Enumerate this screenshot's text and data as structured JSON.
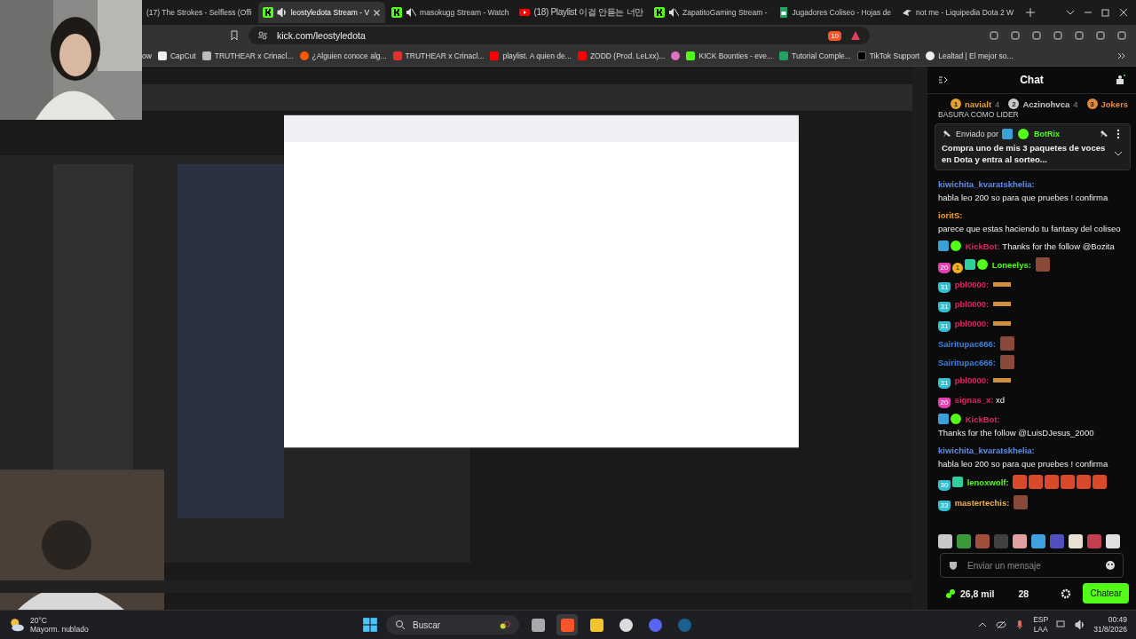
{
  "tabs": [
    {
      "title": "(17) The Strokes - Selfless (Offi",
      "selected": false
    },
    {
      "title": "leostyledota Stream - V",
      "kind": "kick",
      "playing": true,
      "muted": false,
      "selected": true
    },
    {
      "title": "masokugg Stream - Watch",
      "kind": "kick",
      "playing": true,
      "muted": true,
      "selected": false
    },
    {
      "title": "(18) Playlist 이걸 안듣는 너만",
      "kind": "youtube",
      "selected": false
    },
    {
      "title": "ZapatitoGaming Stream -",
      "kind": "kick",
      "playing": true,
      "muted": true,
      "selected": false
    },
    {
      "title": "Jugadores Coliseo - Hojas de",
      "kind": "sheets",
      "selected": false
    },
    {
      "title": "not me - Liquipedia Dota 2 W",
      "kind": "liquipedia",
      "selected": false
    }
  ],
  "address": {
    "url": "kick.com/leostyledota",
    "shield_count": "10"
  },
  "bookmarks": [
    {
      "label": "ow"
    },
    {
      "label": "CapCut",
      "kind": "capcut"
    },
    {
      "label": "TRUTHEAR x Crinacl...",
      "kind": "truthear"
    },
    {
      "label": "¿Alguien conoce alg...",
      "kind": "reddit"
    },
    {
      "label": "TRUTHEAR x Crinacl...",
      "kind": "shop"
    },
    {
      "label": "playlist. A quien de...",
      "kind": "youtube"
    },
    {
      "label": "ZODD (Prod. LeLxx)...",
      "kind": "youtube"
    },
    {
      "kind": "dot"
    },
    {
      "label": "KICK Bounties - eve...",
      "kind": "kick"
    },
    {
      "label": "Tutorial Comple...",
      "kind": "sheets"
    },
    {
      "label": "TikTok Support",
      "kind": "tiktok"
    },
    {
      "label": "Lealtad | El mejor so...",
      "kind": "bird"
    }
  ],
  "chat": {
    "title": "Chat",
    "leaders": [
      {
        "rank": "1",
        "name": "navialt",
        "count": "4",
        "color": "#e0a030"
      },
      {
        "rank": "2",
        "name": "Aczinohvca",
        "count": "4",
        "color": "#c8c8c8"
      },
      {
        "rank": "3",
        "name": "Jokers",
        "color": "#e08a40"
      }
    ],
    "clipped_message": "BASURA COMO LIDER",
    "pinned": {
      "label": "Enviado por",
      "user": "BotRix",
      "text": "Compra uno de mis 3 paquetes de voces en Dota y entra al sorteo..."
    },
    "messages": [
      {
        "user": "kiwichita_kvaratskhelia:",
        "color": "#5b8def",
        "text": "habla leo 200 so para que pruebes ! confirma"
      },
      {
        "user": "ioritS:",
        "color": "#f0a030",
        "text": "parece que estas haciendo tu fantasy del coliseo"
      },
      {
        "user": "KickBot:",
        "color": "#e0245e",
        "badges": [
          {
            "kind": "mod"
          },
          {
            "kind": "verified"
          }
        ],
        "text": "Thanks for the follow @Bozita"
      },
      {
        "user": "Loneelys:",
        "color": "#53fc18",
        "badges": [
          {
            "kind": "sub",
            "label": "20",
            "color": "#e040b0"
          },
          {
            "kind": "coin",
            "label": "1",
            "color": "#f0b020"
          },
          {
            "kind": "gift"
          },
          {
            "kind": "verified"
          }
        ],
        "emotes": [
          {
            "kind": "face"
          }
        ]
      },
      {
        "user": "pbl0000:",
        "color": "#e0245e",
        "badges": [
          {
            "kind": "sub",
            "label": "31",
            "color": "#30c0d0"
          }
        ],
        "emotes": [
          {
            "kind": "bar"
          }
        ]
      },
      {
        "user": "pbl0000:",
        "color": "#e0245e",
        "badges": [
          {
            "kind": "sub",
            "label": "31",
            "color": "#30c0d0"
          }
        ],
        "emotes": [
          {
            "kind": "bar"
          }
        ]
      },
      {
        "user": "pbl0000:",
        "color": "#e0245e",
        "badges": [
          {
            "kind": "sub",
            "label": "31",
            "color": "#30c0d0"
          }
        ],
        "emotes": [
          {
            "kind": "bar"
          }
        ]
      },
      {
        "user": "Sairitupac666:",
        "color": "#3f7fe0",
        "emotes": [
          {
            "kind": "face"
          }
        ]
      },
      {
        "user": "Sairitupac666:",
        "color": "#3f7fe0",
        "emotes": [
          {
            "kind": "face"
          }
        ]
      },
      {
        "user": "pbl0000:",
        "color": "#e0245e",
        "badges": [
          {
            "kind": "sub",
            "label": "31",
            "color": "#30c0d0"
          }
        ],
        "emotes": [
          {
            "kind": "bar"
          }
        ]
      },
      {
        "user": "signas_x:",
        "color": "#e0245e",
        "badges": [
          {
            "kind": "sub",
            "label": "20",
            "color": "#e040b0"
          }
        ],
        "text": "xd"
      },
      {
        "user": "KickBot:",
        "color": "#e0245e",
        "badges": [
          {
            "kind": "mod"
          },
          {
            "kind": "verified"
          }
        ],
        "text": "Thanks for the follow @LuisDJesus_2000"
      },
      {
        "user": "kiwichita_kvaratskhelia:",
        "color": "#5b8def",
        "text": "habla leo 200 so para que pruebes ! confirma"
      },
      {
        "user": "lenoxwolf:",
        "color": "#53fc18",
        "badges": [
          {
            "kind": "sub",
            "label": "30",
            "color": "#30c0d0"
          },
          {
            "kind": "gift"
          }
        ],
        "emotes": [
          {
            "kind": "red"
          },
          {
            "kind": "red"
          },
          {
            "kind": "red"
          },
          {
            "kind": "red"
          },
          {
            "kind": "red"
          },
          {
            "kind": "red"
          }
        ]
      },
      {
        "user": "mastertechis:",
        "color": "#f0b040",
        "badges": [
          {
            "kind": "sub",
            "label": "33",
            "color": "#30c0d0"
          }
        ],
        "emotes": [
          {
            "kind": "face"
          }
        ]
      }
    ],
    "quick_emotes": [
      {
        "color": "#c8c8c8"
      },
      {
        "color": "#3a9a3a"
      },
      {
        "color": "#a0503a"
      },
      {
        "color": "#404040"
      },
      {
        "color": "#e0a0a0"
      },
      {
        "color": "#40a0e0"
      },
      {
        "color": "#5050c0"
      },
      {
        "color": "#e8e0d0"
      },
      {
        "color": "#c04050"
      },
      {
        "color": "#e0e0e0"
      }
    ],
    "input": {
      "placeholder": "Enviar un mensaje"
    },
    "viewers": "26,8 mil",
    "count": "28",
    "send_button": "Chatear"
  },
  "taskbar": {
    "temperature": "20°C",
    "weather": "Mayorm. nublado",
    "search": "Buscar",
    "apps": [
      {
        "kind": "taskview",
        "selected": false
      },
      {
        "kind": "brave",
        "selected": true
      },
      {
        "kind": "folder",
        "selected": false
      },
      {
        "kind": "chrome",
        "selected": false
      },
      {
        "kind": "discord",
        "selected": false
      },
      {
        "kind": "steam",
        "selected": false
      }
    ],
    "language": "ESP",
    "layout": "LAA",
    "time": "00:49",
    "date": "31/8/2026"
  }
}
